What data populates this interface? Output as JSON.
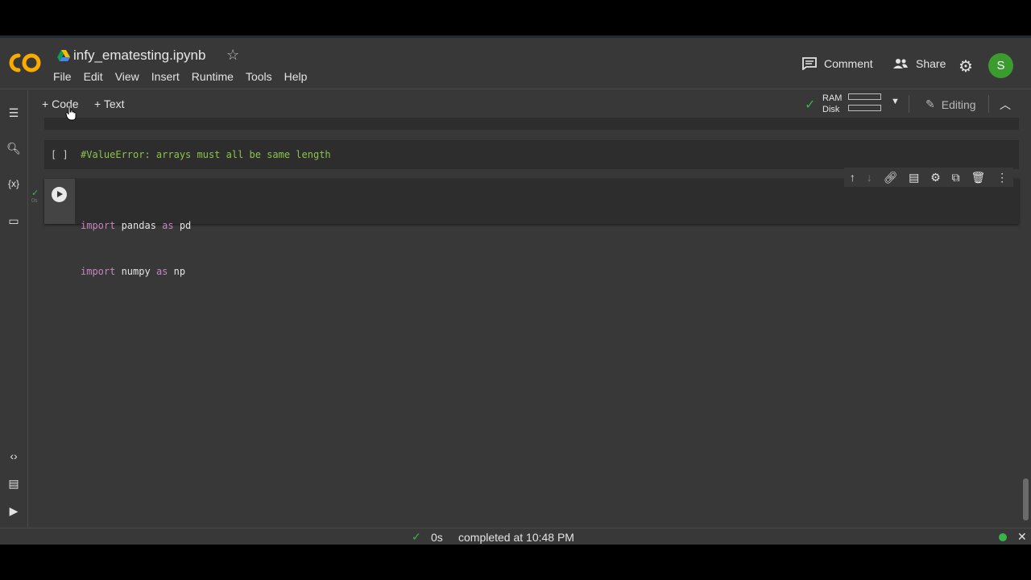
{
  "header": {
    "title": "infy_ematesting.ipynb",
    "logo_text": "CO",
    "menu": [
      "File",
      "Edit",
      "View",
      "Insert",
      "Runtime",
      "Tools",
      "Help"
    ],
    "comment_label": "Comment",
    "share_label": "Share",
    "avatar_letter": "S"
  },
  "toolbar": {
    "add_code_label": "Code",
    "add_text_label": "Text",
    "ram_label": "RAM",
    "disk_label": "Disk",
    "editing_label": "Editing"
  },
  "cells": [
    {
      "prompt": "[ ]",
      "code": "#ValueError: arrays must all be same length"
    },
    {
      "line1_kw1": "import",
      "line1_mod": " pandas ",
      "line1_kw2": "as",
      "line1_alias": " pd",
      "line2_kw1": "import",
      "line2_mod": " numpy ",
      "line2_kw2": "as",
      "line2_alias": " np",
      "exec_time": "0s"
    }
  ],
  "status": {
    "duration": "0s",
    "message": "completed at 10:48 PM"
  },
  "colors": {
    "background": "#383838",
    "cell_bg": "#2d2d2d",
    "accent_green": "#39b44a",
    "logo_orange": "#f9ab00"
  }
}
